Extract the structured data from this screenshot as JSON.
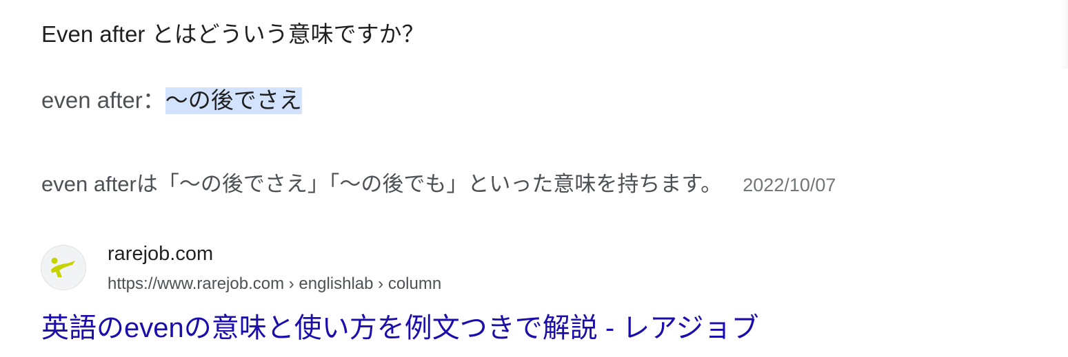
{
  "question": "Even after とはどういう意味ですか？",
  "answer": {
    "term": "even after",
    "separator": "：",
    "meaning": "〜の後でさえ"
  },
  "snippet": {
    "text": "even afterは「〜の後でさえ」「〜の後でも」といった意味を持ちます。",
    "date": "2022/10/07"
  },
  "result": {
    "site_name": "rarejob.com",
    "url_breadcrumb": "https://www.rarejob.com › englishlab › column",
    "title": "英語のevenの意味と使い方を例文つきで解説 - レアジョブ",
    "favicon": "rarejob-logo-icon"
  },
  "colors": {
    "link": "#1a0dab",
    "highlight": "#d3e3fd",
    "logo": "#c5d400"
  }
}
